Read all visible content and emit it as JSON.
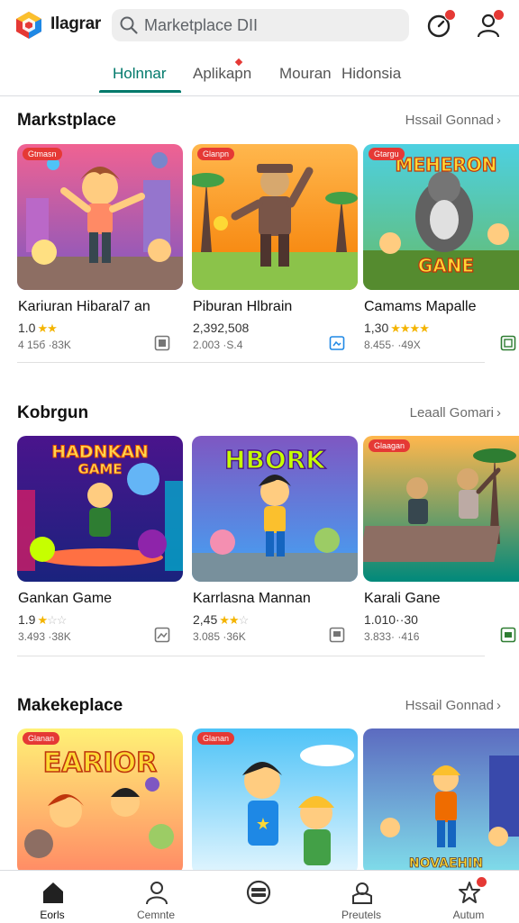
{
  "app": {
    "name": "Ilagrar"
  },
  "search": {
    "placeholder": "Marketplace DII"
  },
  "tabs": [
    {
      "label": "Holnnar",
      "active": true
    },
    {
      "label": "Aplikapn",
      "active": false
    },
    {
      "label": "Mouran",
      "active": false
    },
    {
      "label": "Hidonsia",
      "active": false
    }
  ],
  "sections": [
    {
      "title": "Markstplace",
      "see_all": "Hssail Gonnad",
      "cards": [
        {
          "tag": "Gtmasn",
          "title": "Kariuran Hibaral7 an",
          "rating": "1.0",
          "stars": 2,
          "meta": "4 15б  ·83K",
          "icon": "image-icon"
        },
        {
          "tag": "Glanpn",
          "title": "Piburan Hlbrain",
          "rating": "2,392,508",
          "stars": 0,
          "meta": "2.003  ·S.4",
          "icon": "screen-icon"
        },
        {
          "tag": "Gtargu",
          "title": "Camams Mapalle",
          "rating": "1,30",
          "stars": 4,
          "meta": "8.455· ·49X",
          "icon": "store-icon"
        }
      ]
    },
    {
      "title": "Kobrgun",
      "see_all": "Leaall Gomari",
      "cards": [
        {
          "tag": "",
          "title": "Gankan Game",
          "rating": "1.9",
          "stars": 1,
          "meta": "3.493  ·38K",
          "icon": "image-icon"
        },
        {
          "tag": "",
          "title": "Karrlasna Mannan",
          "rating": "2,45",
          "stars": 2,
          "meta": "3.085  ·36K",
          "icon": "screen-icon"
        },
        {
          "tag": "Glaagan",
          "title": "Karali Gane",
          "rating": "1.010··30",
          "stars": 0,
          "meta": "3.833· ·416",
          "icon": "store-icon"
        }
      ]
    },
    {
      "title": "Makekeplace",
      "see_all": "Hssail Gonnad",
      "cards": [
        {
          "tag": "Glanan",
          "title": "",
          "rating": "",
          "stars": 0,
          "meta": "",
          "icon": ""
        },
        {
          "tag": "Glanan",
          "title": "",
          "rating": "",
          "stars": 0,
          "meta": "",
          "icon": ""
        },
        {
          "tag": "",
          "title": "",
          "rating": "",
          "stars": 0,
          "meta": "",
          "icon": ""
        }
      ]
    }
  ],
  "thumb_texts": {
    "s0c2": [
      "MEHERON",
      "GANE"
    ],
    "s1c0": [
      "HADNKAN",
      "GAME"
    ],
    "s1c1": [
      "HBORK"
    ],
    "s2c0": [
      "EARIOR"
    ],
    "s2c2": [
      "NOVAEHIN"
    ]
  },
  "bottom_nav": [
    {
      "label": "Eorls",
      "icon": "home-icon",
      "active": true
    },
    {
      "label": "Cemnte",
      "icon": "person-icon",
      "active": false
    },
    {
      "label": "",
      "icon": "circle-menu-icon",
      "active": false
    },
    {
      "label": "Preutels",
      "icon": "gift-icon",
      "active": false
    },
    {
      "label": "Autum",
      "icon": "star-person-icon",
      "active": false
    }
  ],
  "colors": {
    "accent": "#00796b",
    "badge": "#e53935",
    "star": "#f4b400"
  }
}
